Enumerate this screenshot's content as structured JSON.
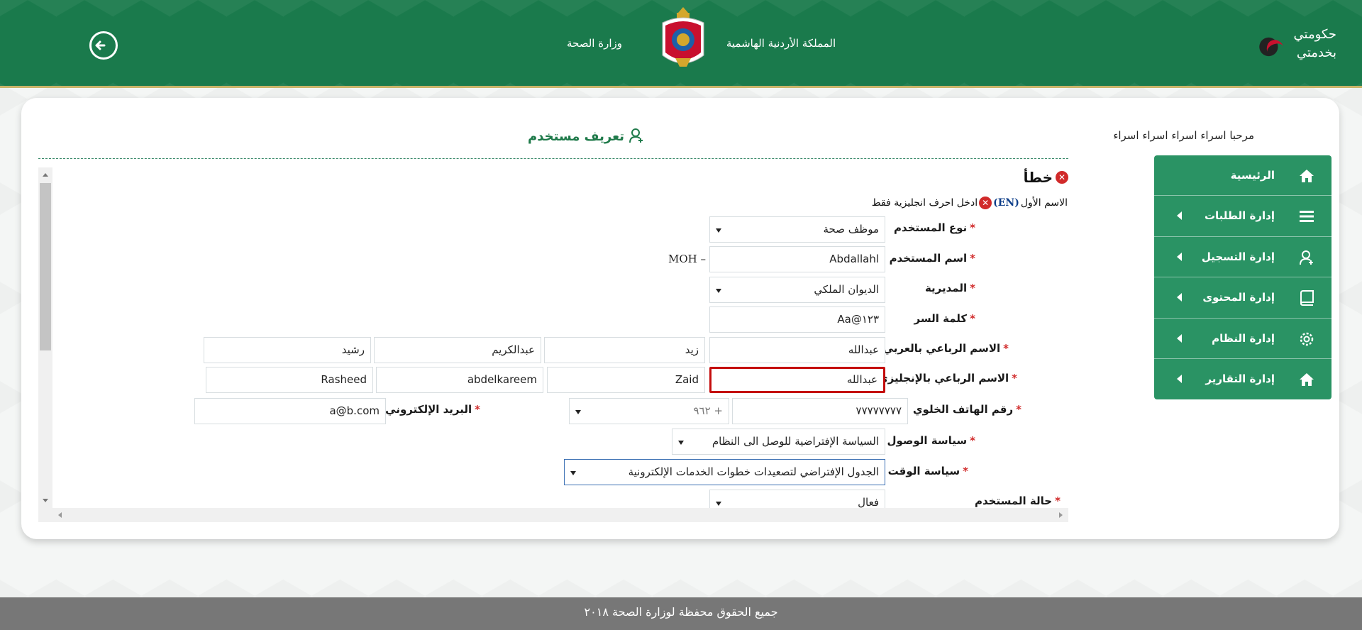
{
  "header": {
    "ministry": "وزارة الصحة",
    "kingdom": "المملكة الأردنية الهاشمية",
    "gov_line1": "حكومتي",
    "gov_line2": "بخدمتي",
    "logout_icon": "logout-icon"
  },
  "welcome": "مرحبا اسراء اسراء اسراء اسراء",
  "sidebar": {
    "items": [
      {
        "label": "الرئيسية",
        "icon": "home-icon",
        "has_caret": false
      },
      {
        "label": "إدارة الطلبات",
        "icon": "list-icon",
        "has_caret": true
      },
      {
        "label": "إدارة التسجيل",
        "icon": "user-add-icon",
        "has_caret": true
      },
      {
        "label": "إدارة المحتوى",
        "icon": "book-icon",
        "has_caret": true
      },
      {
        "label": "إدارة النظام",
        "icon": "gear-icon",
        "has_caret": true
      },
      {
        "label": "إدارة التقارير",
        "icon": "home-icon",
        "has_caret": true
      }
    ]
  },
  "panel": {
    "title": "تعريف مستخدم",
    "error_title": "خطأ",
    "error_field": "الاسم الأول",
    "error_en": "(EN)",
    "error_msg": "ادخل احرف انجليزية فقط"
  },
  "form": {
    "user_type": {
      "label": "نوع المستخدم",
      "value": "موظف صحة"
    },
    "username": {
      "label": "اسم المستخدم",
      "value": "Abdallahl",
      "suffix": "MOH"
    },
    "directorate": {
      "label": "المديرية",
      "value": "الديوان الملكي"
    },
    "password": {
      "label": "كلمة السر",
      "value": "Aa@١٢٣"
    },
    "name_ar": {
      "label": "الاسم الرباعي بالعربي",
      "first": "عبدالله",
      "second": "زيد",
      "third": "عبدالكريم",
      "fourth": "رشيد"
    },
    "name_en": {
      "label": "الاسم الرباعي بالإنجليزي",
      "first": "عبدالله",
      "second": "Zaid",
      "third": "abdelkareem",
      "fourth": "Rasheed"
    },
    "mobile": {
      "label": "رقم الهاتف الخلوي",
      "value": "٧٧٧٧٧٧٧٧",
      "code": "+ ٩٦٢"
    },
    "email": {
      "label": "البريد الإلكتروني",
      "value": "a@b.com"
    },
    "access_policy": {
      "label": "سياسة الوصول",
      "value": "السياسة الإفتراضية للوصل الى النظام"
    },
    "time_policy": {
      "label": "سياسة الوقت",
      "value": "الجدول الإفتراضي لتصعيدات خطوات الخدمات الإلكترونية"
    },
    "user_status": {
      "label": "حالة المستخدم",
      "value": "فعال"
    }
  },
  "footer": "جميع الحقوق محفظة لوزارة الصحة ٢٠١٨"
}
